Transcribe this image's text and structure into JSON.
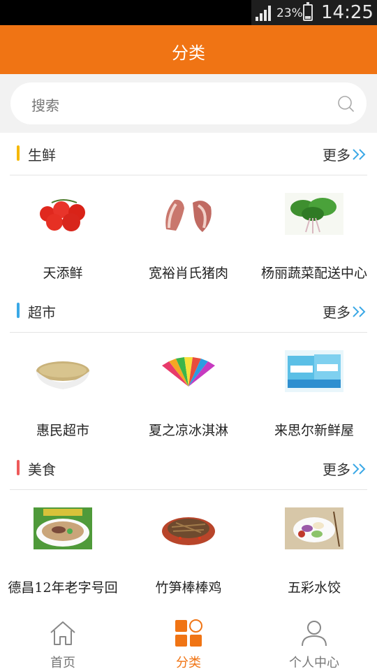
{
  "status_bar": {
    "battery": "23%",
    "time": "14:25"
  },
  "header": {
    "title": "分类"
  },
  "search": {
    "placeholder": "搜索"
  },
  "colors": {
    "brand": "#f07414",
    "sec_fresh": "#f5b800",
    "sec_market": "#3aa8e6",
    "sec_food": "#ee5a5a",
    "more_arrow": "#3aa8e6"
  },
  "sections": [
    {
      "title": "生鲜",
      "more": "更多",
      "items": [
        {
          "name": "天添鲜",
          "icon": "tomato-image"
        },
        {
          "name": "宽裕肖氏猪肉",
          "icon": "pork-image"
        },
        {
          "name": "杨丽蔬菜配送中心",
          "icon": "greens-image"
        }
      ]
    },
    {
      "title": "超市",
      "more": "更多",
      "items": [
        {
          "name": "惠民超市",
          "icon": "rice-image"
        },
        {
          "name": "夏之凉冰淇淋",
          "icon": "icecream-image"
        },
        {
          "name": "来思尔新鲜屋",
          "icon": "milk-image"
        }
      ]
    },
    {
      "title": "美食",
      "more": "更多",
      "items": [
        {
          "name": "德昌12年老字号回",
          "icon": "noodle-soup-image"
        },
        {
          "name": "竹笋棒棒鸡",
          "icon": "chicken-image"
        },
        {
          "name": "五彩水饺",
          "icon": "dumplings-image"
        }
      ]
    }
  ],
  "tabs": [
    {
      "label": "首页",
      "icon": "home-icon",
      "active": false
    },
    {
      "label": "分类",
      "icon": "category-icon",
      "active": true
    },
    {
      "label": "个人中心",
      "icon": "user-icon",
      "active": false
    }
  ]
}
